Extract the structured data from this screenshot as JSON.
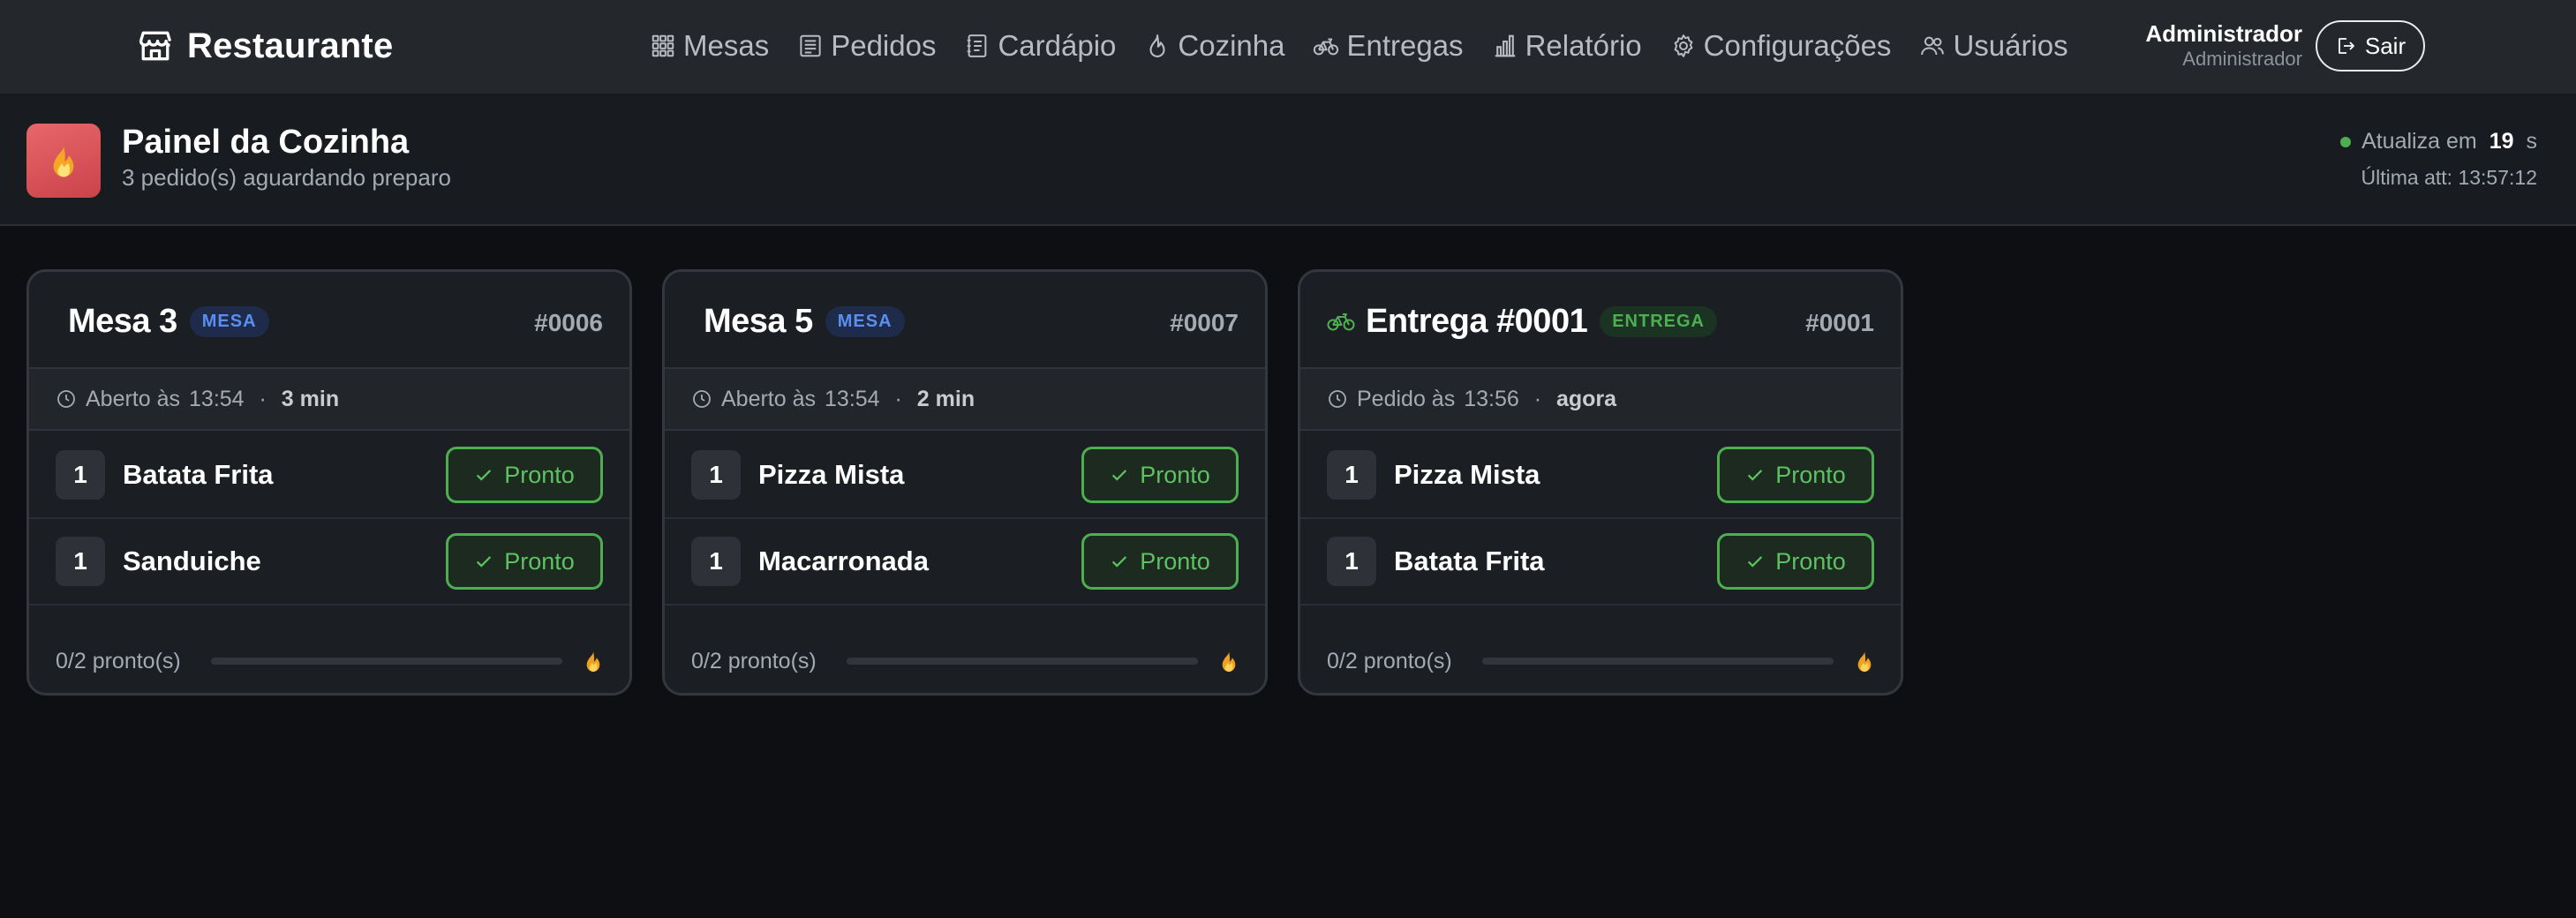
{
  "app": {
    "brand": "Restaurante",
    "brand_icon": "store-icon"
  },
  "nav": [
    {
      "label": "Mesas",
      "icon": "grid-icon"
    },
    {
      "label": "Pedidos",
      "icon": "receipt-icon"
    },
    {
      "label": "Cardápio",
      "icon": "menu-book-icon"
    },
    {
      "label": "Cozinha",
      "icon": "flame-icon"
    },
    {
      "label": "Entregas",
      "icon": "bicycle-icon"
    },
    {
      "label": "Relatório",
      "icon": "bar-chart-icon"
    },
    {
      "label": "Configurações",
      "icon": "gear-icon"
    },
    {
      "label": "Usuários",
      "icon": "users-icon"
    }
  ],
  "user": {
    "name": "Administrador",
    "role": "Administrador",
    "logout_label": "Sair"
  },
  "header": {
    "title": "Painel da Cozinha",
    "subtitle": "3 pedido(s) aguardando preparo",
    "refresh_prefix": "Atualiza em",
    "refresh_seconds": "19",
    "refresh_suffix": "s",
    "last_update": "Última att: 13:57:12",
    "status_color": "#4caf50"
  },
  "orders": [
    {
      "title": "Mesa 3",
      "badge": "MESA",
      "number": "#0006",
      "time_label": "Aberto às",
      "time": "13:54",
      "elapsed": "3 min",
      "items": [
        {
          "qty": "1",
          "name": "Batata Frita",
          "action": "Pronto"
        },
        {
          "qty": "1",
          "name": "Sanduiche",
          "action": "Pronto"
        }
      ],
      "progress_text": "0/2 pronto(s)",
      "progress": 0
    },
    {
      "title": "Mesa 5",
      "badge": "MESA",
      "number": "#0007",
      "time_label": "Aberto às",
      "time": "13:54",
      "elapsed": "2 min",
      "items": [
        {
          "qty": "1",
          "name": "Pizza Mista",
          "action": "Pronto"
        },
        {
          "qty": "1",
          "name": "Macarronada",
          "action": "Pronto"
        }
      ],
      "progress_text": "0/2 pronto(s)",
      "progress": 0
    },
    {
      "title": "Entrega #0001",
      "badge": "ENTREGA",
      "number": "#0001",
      "time_label": "Pedido às",
      "time": "13:56",
      "elapsed": "agora",
      "items": [
        {
          "qty": "1",
          "name": "Pizza Mista",
          "action": "Pronto"
        },
        {
          "qty": "1",
          "name": "Batata Frita",
          "action": "Pronto"
        }
      ],
      "progress_text": "0/2 pronto(s)",
      "progress": 0
    }
  ],
  "colors": {
    "accent_green": "#4caf50",
    "badge_blue": "#5a8ef0",
    "kitchen_red": "#e05a5f",
    "flame_orange": "#f0a020"
  }
}
